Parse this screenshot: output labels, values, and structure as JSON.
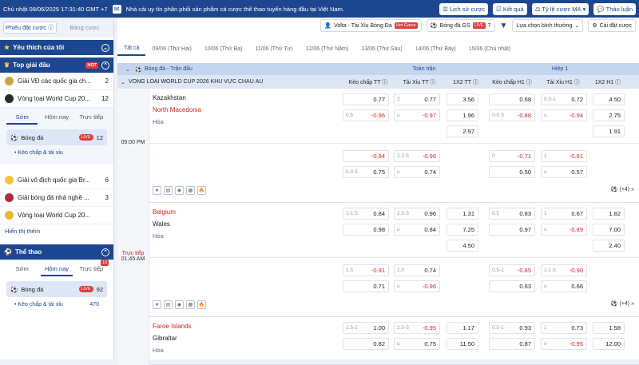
{
  "topbar": {
    "clock": "Chủ nhật 08/06/2025 17:31:40 GMT +7",
    "notice": "Nhà cái uy tín phân phối sản phẩm cá cược thể thao tuyến hàng đầu tại Việt Nam.",
    "btn_history": "Lịch sử cược",
    "btn_results": "Kết quả",
    "btn_odds": "Tỷ lệ cược MA",
    "btn_discuss": "Thảo luận"
  },
  "sidebar": {
    "tab_slip": "Phiếu đặt cược",
    "tab_board": "Bảng cược",
    "fav": "Yêu thích của tôi",
    "top": "Top giải đấu",
    "hot": "HOT",
    "leagues_top": [
      {
        "name": "Giải VĐ các quốc gia ch...",
        "count": "2"
      },
      {
        "name": "Vòng loại World Cup 20...",
        "count": "12"
      }
    ],
    "sub_tabs": [
      "Sớm",
      "Hôm nay",
      "Trực tiếp"
    ],
    "sport": "Bóng đá",
    "live": "LIVE",
    "sport_count": "12",
    "sub_link": "Kèo chấp & tài xỉu",
    "leagues_more": [
      {
        "name": "Giải vô địch quốc gia Br...",
        "count": "6"
      },
      {
        "name": "Giải bóng đá nhà nghề ...",
        "count": "3"
      },
      {
        "name": "Vòng loại World Cup 20...",
        "count": ""
      }
    ],
    "show_all": "Hiển thị thêm",
    "sports": "Thể thao",
    "sport_tabs": [
      "Sớm",
      "Hôm nay",
      "Trực tiếp"
    ],
    "live_count": "10",
    "sport2": "Bóng đá",
    "sport2_count": "92",
    "sub_link2": "Kèo chấp & tài xỉu",
    "sub_link2_count": "470"
  },
  "header": {
    "volta": "Volta - Tài Xỉu Bóng Đá",
    "hot": "Hot Game",
    "gs": "Bóng đá GS",
    "gs_live": "LIVE",
    "gs_count": "7",
    "sort": "Lựa chọn bình thường",
    "settings": "Cài đặt cược"
  },
  "dates": [
    "Tất cả",
    "09/06 (Thứ Hai)",
    "10/06 (Thứ Ba)",
    "11/06 (Thứ Tư)",
    "12/06 (Thứ Năm)",
    "13/06 (Thứ Sáu)",
    "14/06 (Thứ Bảy)",
    "15/06 (Chủ nhật)"
  ],
  "table": {
    "sport_label": "Bóng đá - Trận đấu",
    "full": "Toàn trận",
    "half": "Hiệp 1",
    "league": "VÒNG LOẠI WORLD CUP 2026 KHU VỰC CHÂU ÂU",
    "cols": [
      "Kèo chấp TT",
      "Tài Xỉu TT",
      "1X2 TT",
      "Kèo chấp H1",
      "Tài Xỉu H1",
      "1X2 H1"
    ]
  },
  "matches": [
    {
      "time": "09:00 PM",
      "status": "",
      "home": "Kazakhstan",
      "away": "North Macedonia",
      "draw": "Hòa",
      "plus": "(+4)",
      "l1": {
        "hc_h": "",
        "hc1": "0.77",
        "hc_h2": "0.5",
        "hc2": "-0.96",
        "ou_h": "2",
        "ou1": "0.77",
        "ou_h2": "u",
        "ou2": "-0.97",
        "x1": "3.56",
        "x2": "1.96",
        "x3": "2.97",
        "hh": "",
        "h1": "0.68",
        "hh2": "0-0.5",
        "h2": "-0.88",
        "oh": "0.5-1",
        "o1": "0.72",
        "oh2": "u",
        "o2": "-0.94",
        "y1": "4.50",
        "y2": "2.75",
        "y3": "1.91"
      },
      "l2": {
        "hc_h": "",
        "hc1": "-0.94",
        "hc_h2": "0-0.5",
        "hc2": "0.75",
        "ou_h": "2-2.5",
        "ou1": "-0.96",
        "ou_h2": "u",
        "ou2": "0.74",
        "hh": "0",
        "h1": "-0.71",
        "hh2": "",
        "h2": "0.50",
        "oh": "1",
        "o1": "-0.81",
        "oh2": "u",
        "o2": "0.57"
      }
    },
    {
      "time": "01:45 AM",
      "status": "Trực tiếp",
      "home": "Belgium",
      "away": "Wales",
      "draw": "Hòa",
      "plus": "(+4)",
      "l1": {
        "hc_h": "1-1.5",
        "hc1": "0.84",
        "hc_h2": "",
        "hc2": "0.98",
        "ou_h": "2.5-3",
        "ou1": "0.96",
        "ou_h2": "u",
        "ou2": "0.84",
        "x1": "1.31",
        "x2": "7.25",
        "x3": "4.50",
        "hh": "0.5",
        "h1": "0.83",
        "hh2": "",
        "h2": "0.97",
        "oh": "1",
        "o1": "0.67",
        "oh2": "u",
        "o2": "-0.89",
        "y1": "1.82",
        "y2": "7.00",
        "y3": "2.40"
      },
      "l2": {
        "hc_h": "1.5",
        "hc1": "-0.91",
        "hc_h2": "",
        "hc2": "0.71",
        "ou_h": "2.5",
        "ou1": "0.74",
        "ou_h2": "u",
        "ou2": "-0.96",
        "hh": "0.5-1",
        "h1": "-0.85",
        "hh2": "",
        "h2": "0.63",
        "oh": "1-1.5",
        "o1": "-0.90",
        "oh2": "u",
        "o2": "0.66"
      }
    },
    {
      "time": "",
      "status": "",
      "home": "Faroe Islands",
      "away": "Gibraltar",
      "draw": "Hòa",
      "plus": "",
      "l1": {
        "hc_h": "1.5-2",
        "hc1": "1.00",
        "hc_h2": "",
        "hc2": "0.82",
        "ou_h": "2.5-3",
        "ou1": "-0.95",
        "ou_h2": "u",
        "ou2": "0.75",
        "x1": "1.17",
        "x2": "11.50",
        "x3": "",
        "hh": "0.5-1",
        "h1": "0.93",
        "hh2": "",
        "h2": "0.87",
        "oh": "1",
        "o1": "0.73",
        "oh2": "u",
        "o2": "-0.95",
        "y1": "1.58",
        "y2": "12.00",
        "y3": ""
      }
    }
  ]
}
